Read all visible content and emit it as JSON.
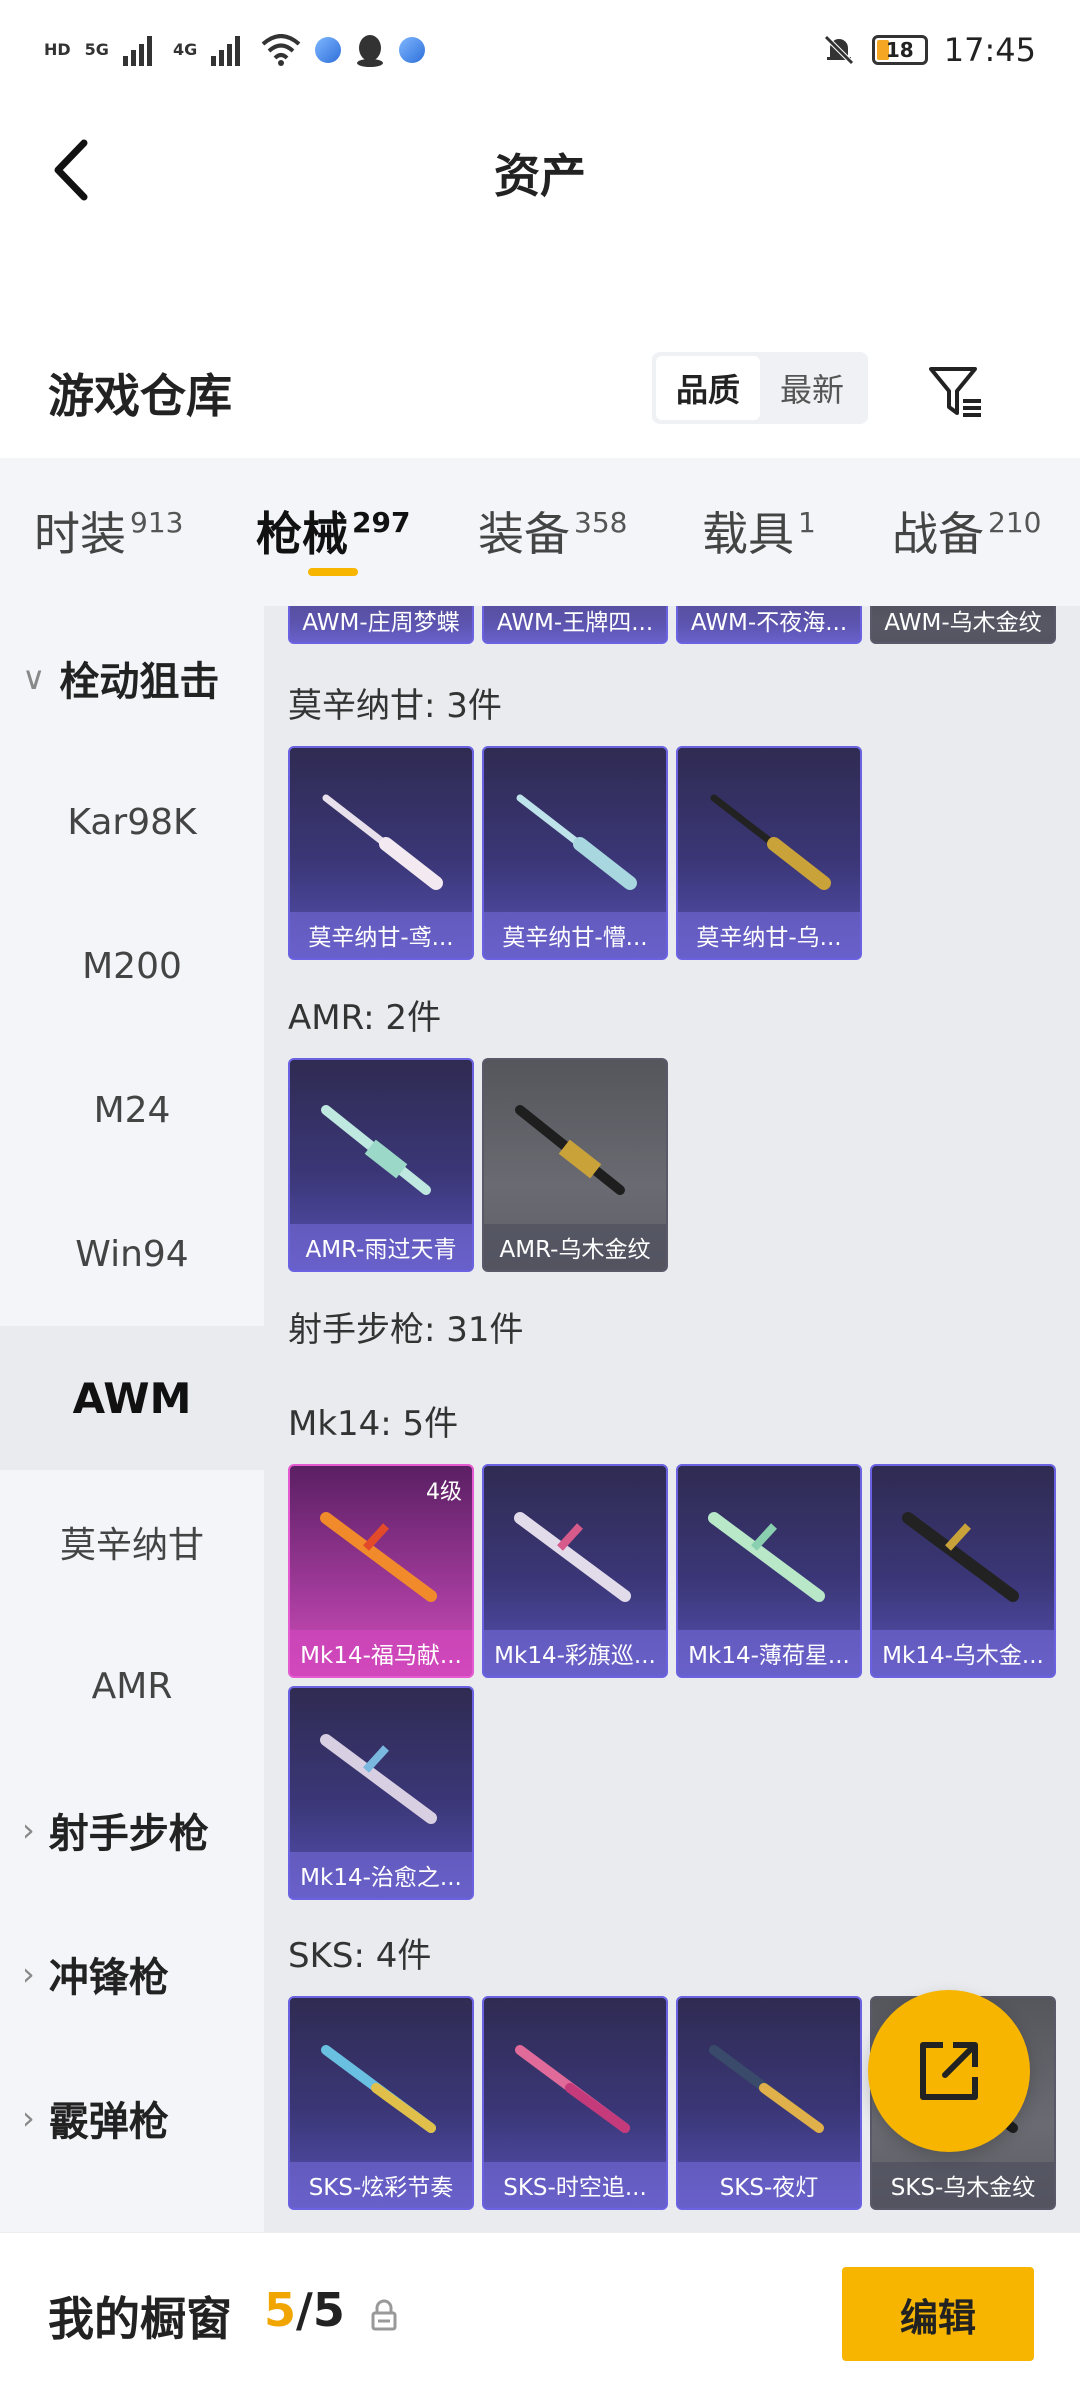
{
  "status_bar": {
    "time": "17:45",
    "battery": "18",
    "net1": "5G",
    "net2": "4G",
    "hd": "HD"
  },
  "header": {
    "title": "资产"
  },
  "section": {
    "title": "游戏仓库",
    "sort_quality": "品质",
    "sort_latest": "最新"
  },
  "tabs": [
    {
      "label": "时装",
      "count": "913"
    },
    {
      "label": "枪械",
      "count": "297"
    },
    {
      "label": "装备",
      "count": "358"
    },
    {
      "label": "载具",
      "count": "1"
    },
    {
      "label": "战备",
      "count": "210"
    }
  ],
  "sidebar": {
    "group_bolt": "栓动狙击",
    "items": [
      "Kar98K",
      "M200",
      "M24",
      "Win94",
      "AWM",
      "莫辛纳甘",
      "AMR"
    ],
    "group_dmr": "射手步枪",
    "group_smg": "冲锋枪",
    "group_shotgun": "霰弹枪"
  },
  "content": {
    "awm_cards": [
      "AWM-庄周梦蝶",
      "AWM-王牌四...",
      "AWM-不夜海...",
      "AWM-乌木金纹"
    ],
    "mosin_label": "莫辛纳甘: 3件",
    "mosin_cards": [
      "莫辛纳甘-鸢...",
      "莫辛纳甘-懵...",
      "莫辛纳甘-乌..."
    ],
    "amr_label": "AMR: 2件",
    "amr_cards": [
      "AMR-雨过天青",
      "AMR-乌木金纹"
    ],
    "dmr_label": "射手步枪: 31件",
    "mk14_label": "Mk14: 5件",
    "mk14_cards": [
      "Mk14-福马献...",
      "Mk14-彩旗巡...",
      "Mk14-薄荷星...",
      "Mk14-乌木金...",
      "Mk14-治愈之..."
    ],
    "mk14_level": "4级",
    "sks_label": "SKS: 4件",
    "sks_cards": [
      "SKS-炫彩节奏",
      "SKS-时空追...",
      "SKS-夜灯",
      "SKS-乌木金纹"
    ]
  },
  "bottom_bar": {
    "title": "我的橱窗",
    "count_current": "5",
    "count_sep": "/",
    "count_total": "5",
    "edit_label": "编辑"
  },
  "colors": {
    "accent": "#f7b500",
    "card_purple": "#3b3778",
    "card_pink": "#d24fb8"
  }
}
